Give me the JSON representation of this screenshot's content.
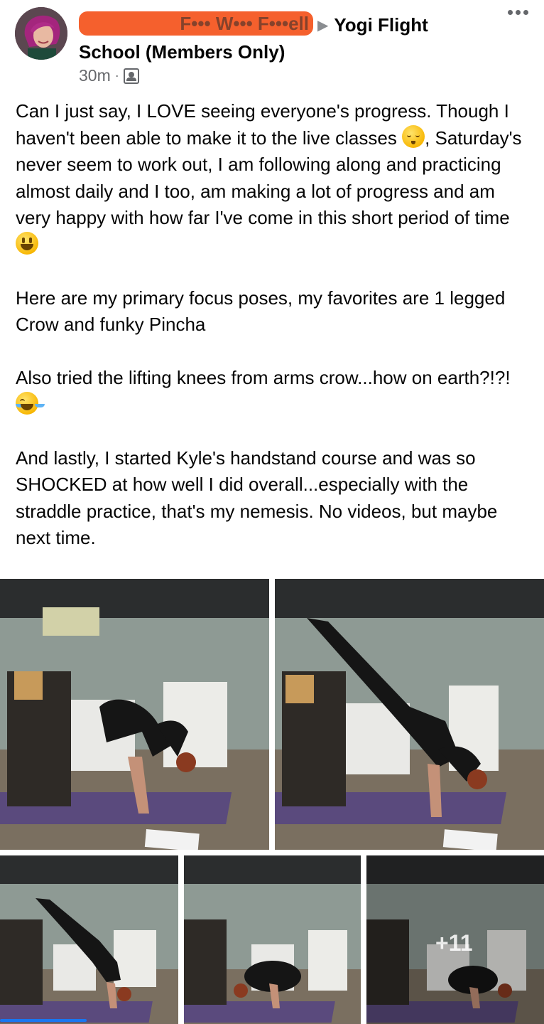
{
  "post": {
    "author_redacted": "F••• W••• F•••ell",
    "arrow": "▶",
    "group": "Yogi Flight School (Members Only)",
    "group_line1": "Yogi Flight",
    "group_line2": "School (Members Only)",
    "timestamp": "30m",
    "separator": "·",
    "audience_icon": "group-audience-icon",
    "more_icon": "more-options-icon"
  },
  "body": {
    "p1_a": "Can I just say, I LOVE seeing everyone's progress. Though I haven't been able to make it to the live classes ",
    "p1_b": ", Saturday's never seem to work out, I am following along and practicing almost daily and I too, am making a lot of progress and am very happy with how far I've come in this short period of time ",
    "p2": "Here are my primary focus poses, my favorites are 1 legged Crow and funky Pincha",
    "p3": "Also tried the lifting knees from arms crow...how on earth?!?! ",
    "p4": "And lastly, I started Kyle's handstand course and was so SHOCKED at how well I did overall...especially with the straddle practice, that's my nemesis. No videos, but maybe next time.",
    "emoji_1": "pensive-face-emoji",
    "emoji_2": "grinning-face-emoji",
    "emoji_3": "tears-of-joy-emoji"
  },
  "photos": {
    "more_count": "+11",
    "colors": {
      "ceiling": "#2b2d2e",
      "wall": "#8e9a94",
      "floor": "#7a6f60",
      "mat": "#5a4a7d",
      "figure": "#151515"
    }
  },
  "accent": "#1877f2"
}
